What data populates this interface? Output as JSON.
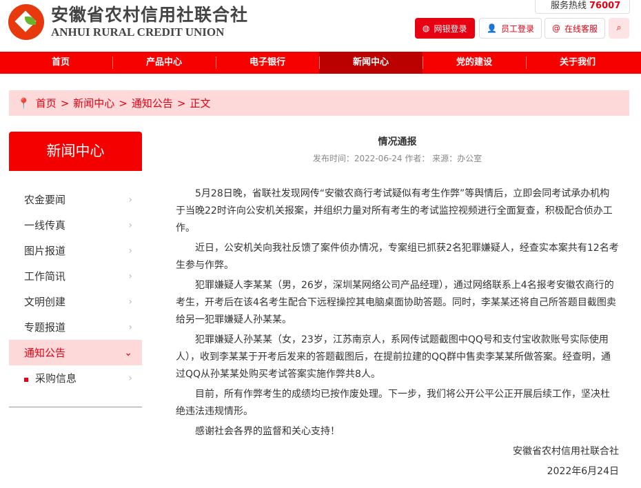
{
  "header": {
    "hotline_label": "服务热线",
    "hotline_number": "76007",
    "logo_cn": "安徽省农村信用社联合社",
    "logo_en": "ANHUI RURAL CREDIT UNION",
    "buttons": [
      {
        "label": "网银登录"
      },
      {
        "label": "员工登录"
      },
      {
        "label": "在线客服"
      }
    ]
  },
  "nav": [
    "首页",
    "产品中心",
    "电子银行",
    "新闻中心",
    "党的建设",
    "关于我们"
  ],
  "breadcrumb": [
    "首页",
    ">",
    "新闻中心",
    ">",
    "通知公告",
    ">",
    "正文"
  ],
  "sidebar": {
    "title": "新闻中心",
    "items": [
      "农金要闻",
      "一线传真",
      "图片报道",
      "工作简讯",
      "文明创建",
      "专题报道",
      "通知公告",
      "采购信息"
    ]
  },
  "article": {
    "title": "情况通报",
    "meta": "发布时间：2022-06-24 作者：  来源：办公室",
    "paragraphs": [
      "5月28日晚，省联社发现网传“安徽农商行考试疑似有考生作弊”等舆情后，立即会同考试承办机构于当晚22时许向公安机关报案，并组织力量对所有考生的考试监控视频进行全面复查，积极配合侦办工作。",
      "近日，公安机关向我社反馈了案件侦办情况，专案组已抓获2名犯罪嫌疑人，经查实本案共有12名考生参与作弊。",
      "犯罪嫌疑人李某某（男，26岁，深圳某网络公司产品经理），通过网络联系上4名报考安徽农商行的考生，开考后在该4名考生配合下远程操控其电脑桌面协助答题。同时，李某某还将自己所答题目截图卖给另一犯罪嫌疑人孙某某。",
      "犯罪嫌疑人孙某某（女，23岁，江苏南京人，系网传试题截图中QQ号和支付宝收款账号实际使用人），收到李某某于开考后发来的答题截图后，在提前拉建的QQ群中售卖李某某所做答案。经查明，通过QQ从孙某某处购买考试答案实施作弊共8人。",
      "目前，所有作弊考生的成绩均已按作废处理。下一步，我们将公开公平公正开展后续工作，坚决杜绝违法违规情形。",
      "感谢社会各界的监督和关心支持！"
    ],
    "signature": "安徽省农村信用社联合社",
    "date": "2022年6月24日"
  }
}
